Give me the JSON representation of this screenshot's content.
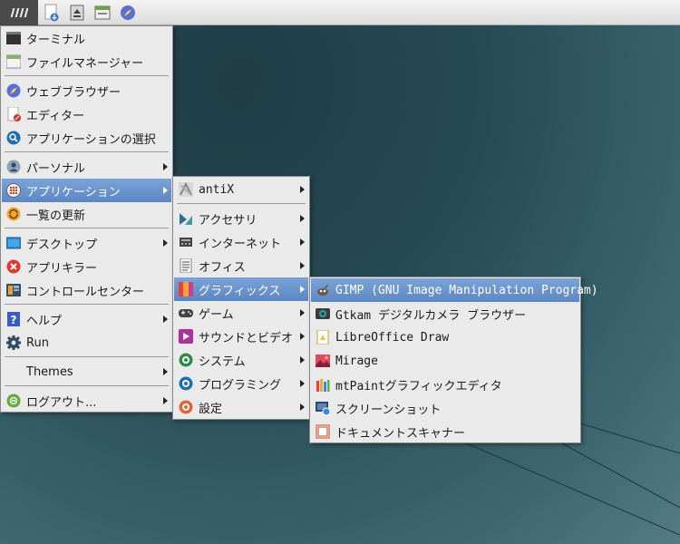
{
  "main_menu": {
    "items": [
      {
        "label": "ターミナル",
        "icon": "terminal-icon"
      },
      {
        "label": "ファイルマネージャー",
        "icon": "file-manager-icon"
      },
      {
        "label": "ウェブブラウザー",
        "icon": "compass-icon"
      },
      {
        "label": "エディター",
        "icon": "editor-icon"
      },
      {
        "label": "アプリケーションの選択",
        "icon": "app-finder-icon"
      },
      {
        "label": "パーソナル",
        "icon": "user-icon"
      },
      {
        "label": "アプリケーション",
        "icon": "grid-icon"
      },
      {
        "label": "一覧の更新",
        "icon": "refresh-icon"
      },
      {
        "label": "デスクトップ",
        "icon": "desktop-icon"
      },
      {
        "label": "アプリキラー",
        "icon": "kill-icon"
      },
      {
        "label": "コントロールセンター",
        "icon": "control-center-icon"
      },
      {
        "label": "ヘルプ",
        "icon": "help-icon"
      },
      {
        "label": "Run",
        "icon": "gear-icon"
      },
      {
        "label": "Themes",
        "icon": ""
      },
      {
        "label": "ログアウト...",
        "icon": "logout-icon"
      }
    ]
  },
  "apps_menu": {
    "items": [
      {
        "label": "antiX",
        "icon": "antix-icon"
      },
      {
        "label": "アクセサリ",
        "icon": "accessories-icon"
      },
      {
        "label": "インターネット",
        "icon": "internet-icon"
      },
      {
        "label": "オフィス",
        "icon": "office-icon"
      },
      {
        "label": "グラフィックス",
        "icon": "graphics-icon"
      },
      {
        "label": "ゲーム",
        "icon": "gamepad-icon"
      },
      {
        "label": "サウンドとビデオ",
        "icon": "multimedia-icon"
      },
      {
        "label": "システム",
        "icon": "system-icon"
      },
      {
        "label": "プログラミング",
        "icon": "programming-icon"
      },
      {
        "label": "設定",
        "icon": "settings-icon"
      }
    ]
  },
  "graphics_menu": {
    "items": [
      {
        "label": "GIMP (GNU Image Manipulation Program)",
        "icon": "gimp-icon"
      },
      {
        "label": "Gtkam デジタルカメラ ブラウザー",
        "icon": "camera-icon"
      },
      {
        "label": "LibreOffice Draw",
        "icon": "libreoffice-draw-icon"
      },
      {
        "label": "Mirage",
        "icon": "image-viewer-icon"
      },
      {
        "label": "mtPaintグラフィックエディタ",
        "icon": "paint-icon"
      },
      {
        "label": "スクリーンショット",
        "icon": "screenshot-icon"
      },
      {
        "label": "ドキュメントスキャナー",
        "icon": "scanner-icon"
      }
    ]
  },
  "taskbar": {
    "icons": [
      "menu-icon",
      "file-manager-icon",
      "eject-icon",
      "file-manager-icon",
      "browser-icon"
    ]
  },
  "colors": {
    "selection": "#6a92cc",
    "menu_bg": "#eaeaea"
  }
}
